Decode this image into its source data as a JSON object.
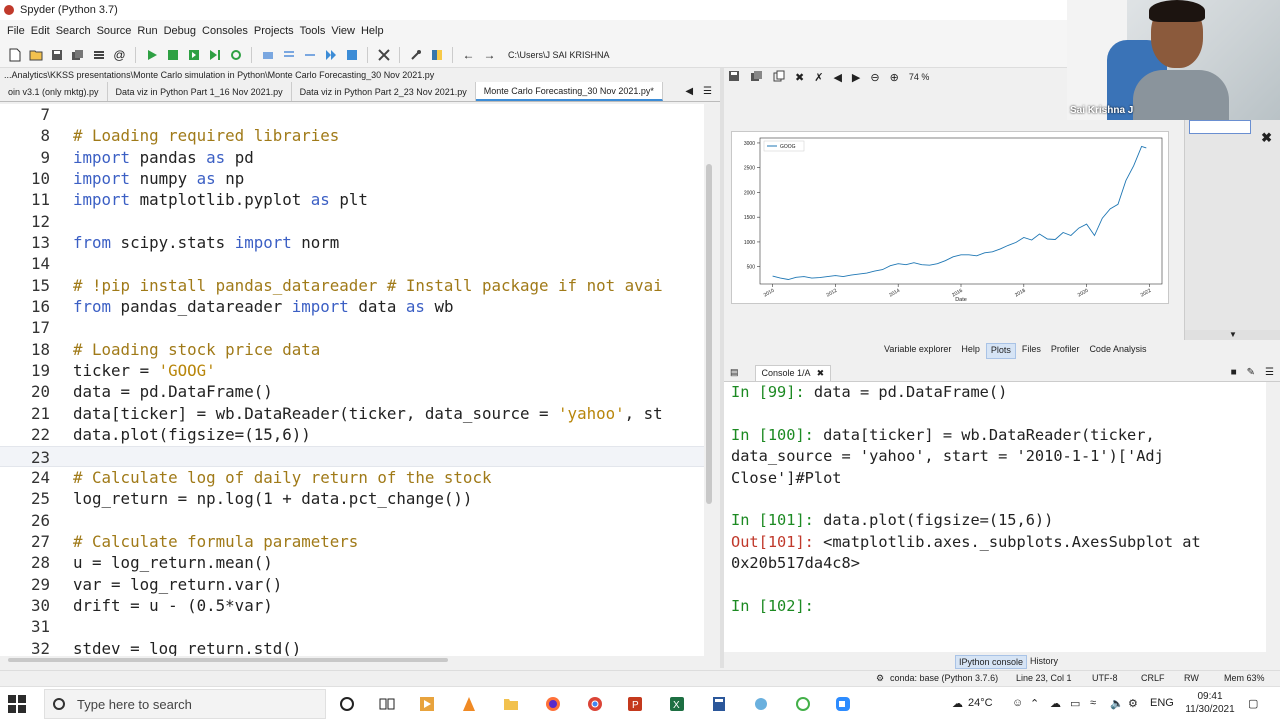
{
  "window": {
    "title": "Spyder (Python 3.7)"
  },
  "menubar": [
    "File",
    "Edit",
    "Search",
    "Source",
    "Run",
    "Debug",
    "Consoles",
    "Projects",
    "Tools",
    "View",
    "Help"
  ],
  "toolbar": {
    "working_dir": "C:\\Users\\J SAI KRISHNA"
  },
  "editor": {
    "path": "...Analytics\\KKSS presentations\\Monte Carlo simulation in Python\\Monte Carlo Forecasting_30 Nov 2021.py",
    "tabs": [
      {
        "label": "oin v3.1 (only mktg).py",
        "active": false
      },
      {
        "label": "Data viz in Python Part 1_16 Nov 2021.py",
        "active": false
      },
      {
        "label": "Data viz in Python Part 2_23 Nov 2021.py",
        "active": false
      },
      {
        "label": "Monte Carlo Forecasting_30 Nov 2021.py*",
        "active": true
      }
    ],
    "lines": [
      {
        "n": "7",
        "code": ""
      },
      {
        "n": "8",
        "code": "# Loading required libraries"
      },
      {
        "n": "9",
        "code": "import pandas as pd"
      },
      {
        "n": "10",
        "code": "import numpy as np"
      },
      {
        "n": "11",
        "code": "import matplotlib.pyplot as plt"
      },
      {
        "n": "12",
        "code": ""
      },
      {
        "n": "13",
        "code": "from scipy.stats import norm"
      },
      {
        "n": "14",
        "code": ""
      },
      {
        "n": "15",
        "code": "# !pip install pandas_datareader # Install package if not avai"
      },
      {
        "n": "16",
        "code": "from pandas_datareader import data as wb"
      },
      {
        "n": "17",
        "code": ""
      },
      {
        "n": "18",
        "code": "# Loading stock price data"
      },
      {
        "n": "19",
        "code": "ticker = 'GOOG'"
      },
      {
        "n": "20",
        "code": "data = pd.DataFrame()"
      },
      {
        "n": "21",
        "code": "data[ticker] = wb.DataReader(ticker, data_source = 'yahoo', st"
      },
      {
        "n": "22",
        "code": "data.plot(figsize=(15,6))"
      },
      {
        "n": "23",
        "code": ""
      },
      {
        "n": "24",
        "code": "# Calculate log of daily return of the stock"
      },
      {
        "n": "25",
        "code": "log_return = np.log(1 + data.pct_change())"
      },
      {
        "n": "26",
        "code": ""
      },
      {
        "n": "27",
        "code": "# Calculate formula parameters"
      },
      {
        "n": "28",
        "code": "u = log_return.mean()"
      },
      {
        "n": "29",
        "code": "var = log_return.var()"
      },
      {
        "n": "30",
        "code": "drift = u - (0.5*var)"
      },
      {
        "n": "31",
        "code": ""
      },
      {
        "n": "32",
        "code": "stdev = log_return.std()"
      }
    ]
  },
  "plots": {
    "zoom": "74 %",
    "tabs": [
      {
        "label": "Variable explorer",
        "active": false
      },
      {
        "label": "Help",
        "active": false
      },
      {
        "label": "Plots",
        "active": true
      },
      {
        "label": "Files",
        "active": false
      },
      {
        "label": "Profiler",
        "active": false
      },
      {
        "label": "Code Analysis",
        "active": false
      }
    ]
  },
  "chart_data": {
    "type": "line",
    "title": "",
    "xlabel": "Date",
    "ylabel": "",
    "series": [
      {
        "name": "GOOG",
        "color": "#1f77b4",
        "x": [
          2010.0,
          2010.25,
          2010.5,
          2010.75,
          2011.0,
          2011.25,
          2011.5,
          2011.75,
          2012.0,
          2012.25,
          2012.5,
          2012.75,
          2013.0,
          2013.25,
          2013.5,
          2013.75,
          2014.0,
          2014.25,
          2014.5,
          2014.75,
          2015.0,
          2015.25,
          2015.5,
          2015.75,
          2016.0,
          2016.25,
          2016.5,
          2016.75,
          2017.0,
          2017.25,
          2017.5,
          2017.75,
          2018.0,
          2018.25,
          2018.5,
          2018.75,
          2019.0,
          2019.25,
          2019.5,
          2019.75,
          2020.0,
          2020.25,
          2020.5,
          2020.75,
          2021.0,
          2021.25,
          2021.5,
          2021.75,
          2021.9
        ],
        "y": [
          310,
          270,
          240,
          285,
          300,
          270,
          280,
          300,
          320,
          300,
          330,
          350,
          370,
          410,
          440,
          520,
          560,
          540,
          580,
          540,
          530,
          560,
          620,
          700,
          740,
          740,
          720,
          780,
          800,
          860,
          930,
          990,
          1090,
          1040,
          1160,
          1060,
          1050,
          1190,
          1130,
          1280,
          1360,
          1130,
          1480,
          1670,
          1760,
          2240,
          2540,
          2930,
          2900
        ]
      }
    ],
    "xticks": [
      "2010",
      "2012",
      "2014",
      "2016",
      "2018",
      "2020",
      "2022"
    ],
    "yticks": [
      "500",
      "1000",
      "1500",
      "2000",
      "2500",
      "3000"
    ],
    "xlim": [
      2009.6,
      2022.4
    ],
    "ylim": [
      150,
      3100
    ],
    "legend": "top-left",
    "grid": false
  },
  "console": {
    "tab_label": "Console 1/A",
    "entries": [
      {
        "kind": "in",
        "prompt": "In [99]: ",
        "text": "data = pd.DataFrame()"
      },
      {
        "kind": "blank"
      },
      {
        "kind": "in",
        "prompt": "In [100]: ",
        "text": "data[ticker] = wb.DataReader(ticker,"
      },
      {
        "kind": "cont",
        "text": "data_source = 'yahoo', start = '2010-1-1')['Adj"
      },
      {
        "kind": "cont",
        "text": "Close']#Plot"
      },
      {
        "kind": "blank"
      },
      {
        "kind": "in",
        "prompt": "In [101]: ",
        "text": "data.plot(figsize=(15,6))"
      },
      {
        "kind": "out",
        "prompt": "Out[101]: ",
        "text": "<matplotlib.axes._subplots.AxesSubplot at"
      },
      {
        "kind": "cont",
        "text": "0x20b517da4c8>"
      },
      {
        "kind": "blank"
      },
      {
        "kind": "in",
        "prompt": "In [102]: ",
        "text": ""
      }
    ],
    "bottom_tabs": [
      {
        "label": "IPython console",
        "active": true
      },
      {
        "label": "History",
        "active": false
      }
    ]
  },
  "statusbar": {
    "conda": "conda: base (Python 3.7.6)",
    "position": "Line 23, Col 1",
    "encoding": "UTF-8",
    "eol": "CRLF",
    "rw": "RW",
    "mem": "Mem 63%"
  },
  "taskbar": {
    "search_placeholder": "Type here to search",
    "weather": "24°C",
    "lang": "ENG",
    "time": "09:41",
    "date": "11/30/2021"
  },
  "webcam": {
    "name": "Sai Krishna J"
  }
}
